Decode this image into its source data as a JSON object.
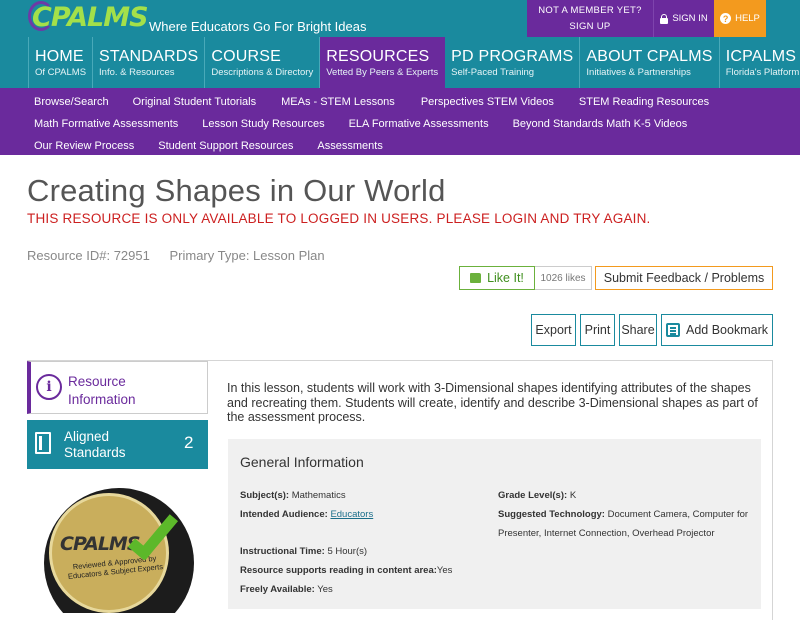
{
  "header": {
    "logo": "CPALMS",
    "tagline": "Where Educators Go For Bright Ideas",
    "not_member": "NOT A MEMBER YET?",
    "sign_up": "SIGN UP",
    "sign_in": "SIGN IN",
    "help": "HELP",
    "help_glyph": "?"
  },
  "main_nav": [
    {
      "title": "HOME",
      "sub": "Of CPALMS"
    },
    {
      "title": "STANDARDS",
      "sub": "Info. & Resources"
    },
    {
      "title": "COURSE",
      "sub": "Descriptions & Directory"
    },
    {
      "title": "RESOURCES",
      "sub": "Vetted By Peers & Experts"
    },
    {
      "title": "PD PROGRAMS",
      "sub": "Self-Paced Training"
    },
    {
      "title": "ABOUT CPALMS",
      "sub": "Initiatives & Partnerships"
    },
    {
      "title": "ICPALMS",
      "sub": "Florida's Platform"
    }
  ],
  "sub_nav": {
    "row1": [
      "Browse/Search",
      "Original Student Tutorials",
      "MEAs - STEM Lessons",
      "Perspectives STEM Videos",
      "STEM Reading Resources"
    ],
    "row2": [
      "Math Formative Assessments",
      "Lesson Study Resources",
      "ELA Formative Assessments",
      "Beyond Standards Math K-5 Videos"
    ],
    "row3": [
      "Our Review Process",
      "Student Support Resources",
      "Assessments"
    ]
  },
  "resource": {
    "title": "Creating Shapes in Our World",
    "warning": "THIS RESOURCE IS ONLY AVAILABLE TO LOGGED IN USERS. PLEASE LOGIN AND TRY AGAIN.",
    "id_label": "Resource ID#: 72951",
    "type_label": "Primary Type: Lesson Plan",
    "like_label": "Like It!",
    "likes": "1026 likes",
    "feedback": "Submit Feedback / Problems",
    "description": "In this lesson, students will work with 3-Dimensional shapes identifying attributes of the shapes and recreating them. Students will create, identify and describe 3-Dimensional shapes as part of the assessment process."
  },
  "toolbar": {
    "export": "Export",
    "print": "Print",
    "share": "Share",
    "bookmark": "Add Bookmark"
  },
  "sidebar": {
    "info_glyph": "i",
    "resource_info": "Resource Information",
    "aligned": "Aligned Standards",
    "aligned_count": "2",
    "seal_logo": "CPALMS",
    "seal_text": "Reviewed & Approved by Educators & Subject Experts"
  },
  "general_info": {
    "title": "General Information",
    "subjects_label": "Subject(s):",
    "subjects": "Mathematics",
    "grade_label": "Grade Level(s):",
    "grade": "K",
    "audience_label": "Intended Audience:",
    "audience": "Educators",
    "tech_label": "Suggested Technology:",
    "tech": "Document Camera, Computer for Presenter, Internet Connection, Overhead Projector",
    "time_label": "Instructional Time:",
    "time": "5 Hour(s)",
    "reading_label": "Resource supports reading in content area:",
    "reading": "Yes",
    "free_label": "Freely Available:",
    "free": "Yes"
  },
  "colors": {
    "teal": "#1a8a9e",
    "purple": "#6a2a9c",
    "orange": "#f39a1e",
    "green": "#6bb13c",
    "warning_red": "#cc2020"
  }
}
